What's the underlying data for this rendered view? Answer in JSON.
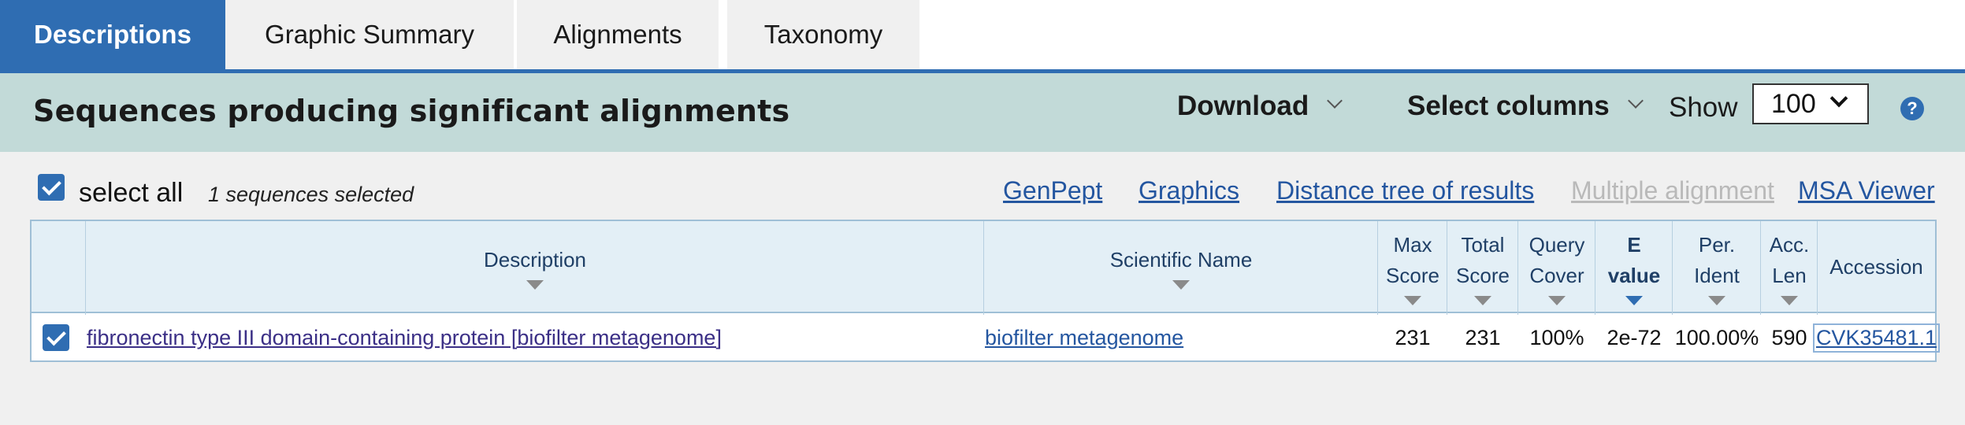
{
  "tabs": [
    {
      "label": "Descriptions",
      "active": true
    },
    {
      "label": "Graphic Summary",
      "active": false
    },
    {
      "label": "Alignments",
      "active": false
    },
    {
      "label": "Taxonomy",
      "active": false
    }
  ],
  "header": {
    "title": "Sequences producing significant alignments",
    "download_label": "Download",
    "select_columns_label": "Select columns",
    "show_label": "Show",
    "show_value": "100",
    "help_icon": "?"
  },
  "toolbar": {
    "select_all_label": "select all",
    "select_all_checked": true,
    "selected_count": "1 sequences selected",
    "links": [
      "GenPept",
      "Graphics",
      "Distance tree of results",
      "Multiple alignment",
      "MSA Viewer"
    ],
    "disabled_link": "Multiple alignment"
  },
  "table": {
    "headers": {
      "description": "Description",
      "scientific_name": "Scientific Name",
      "max_score": [
        "Max",
        "Score"
      ],
      "total_score": [
        "Total",
        "Score"
      ],
      "query_cover": [
        "Query",
        "Cover"
      ],
      "e_value": [
        "E",
        "value"
      ],
      "per_ident": [
        "Per.",
        "Ident"
      ],
      "acc_len": [
        "Acc.",
        "Len"
      ],
      "accession": "Accession"
    },
    "sorted_column": "e_value",
    "rows": [
      {
        "checked": true,
        "description": "fibronectin type III domain-containing protein [biofilter metagenome]",
        "scientific_name": "biofilter metagenome",
        "max_score": "231",
        "total_score": "231",
        "query_cover": "100%",
        "e_value": "2e-72",
        "per_ident": "100.00%",
        "acc_len": "590",
        "accession": "CVK35481.1"
      }
    ]
  },
  "colors": {
    "tab_active": "#2f6db2",
    "header_bar": "#c2dad8",
    "panel": "#f0f0f0",
    "link": "#2456a0",
    "table_header": "#e3eff6"
  }
}
